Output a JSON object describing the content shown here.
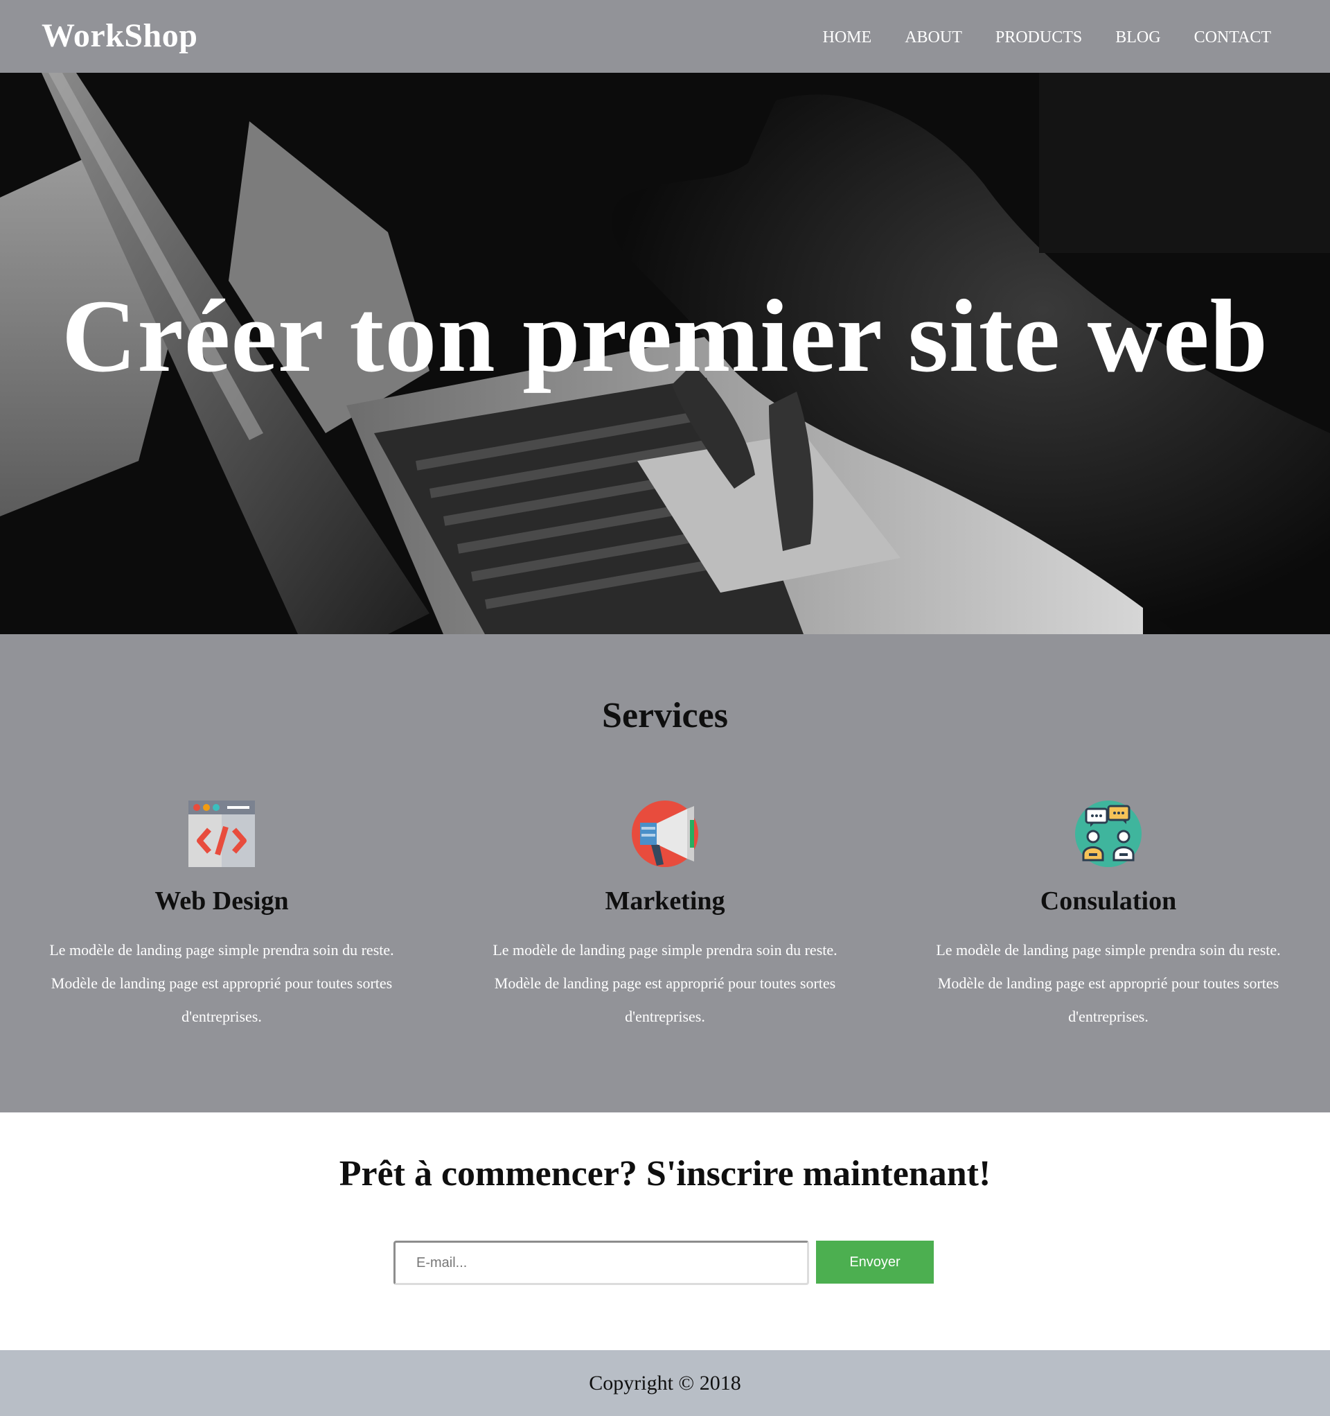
{
  "header": {
    "logo": "WorkShop",
    "nav": [
      "HOME",
      "ABOUT",
      "PRODUCTS",
      "BLOG",
      "CONTACT"
    ]
  },
  "hero": {
    "title": "Créer ton premier site web",
    "image": "laptop-typing-photo"
  },
  "services": {
    "title": "Services",
    "items": [
      {
        "title": "Web Design",
        "icon": "code-window-icon",
        "text": "Le modèle de landing page simple prendra soin du reste. Modèle de landing page est approprié pour toutes sortes d'entreprises."
      },
      {
        "title": "Marketing",
        "icon": "megaphone-icon",
        "text": "Le modèle de landing page simple prendra soin du reste. Modèle de landing page est approprié pour toutes sortes d'entreprises."
      },
      {
        "title": "Consulation",
        "icon": "consultation-icon",
        "text": "Le modèle de landing page simple prendra soin du reste. Modèle de landing page est approprié pour toutes sortes d'entreprises."
      }
    ]
  },
  "signup": {
    "title": "Prêt à commencer? S'inscrire maintenant!",
    "email_placeholder": "E-mail...",
    "email_value": "",
    "button_label": "Envoyer"
  },
  "footer": {
    "copyright": "Copyright © 2018"
  },
  "colors": {
    "header_bg": "#929398",
    "services_bg": "#929398",
    "button_bg": "#4caf50",
    "footer_bg": "#b8bec6"
  }
}
